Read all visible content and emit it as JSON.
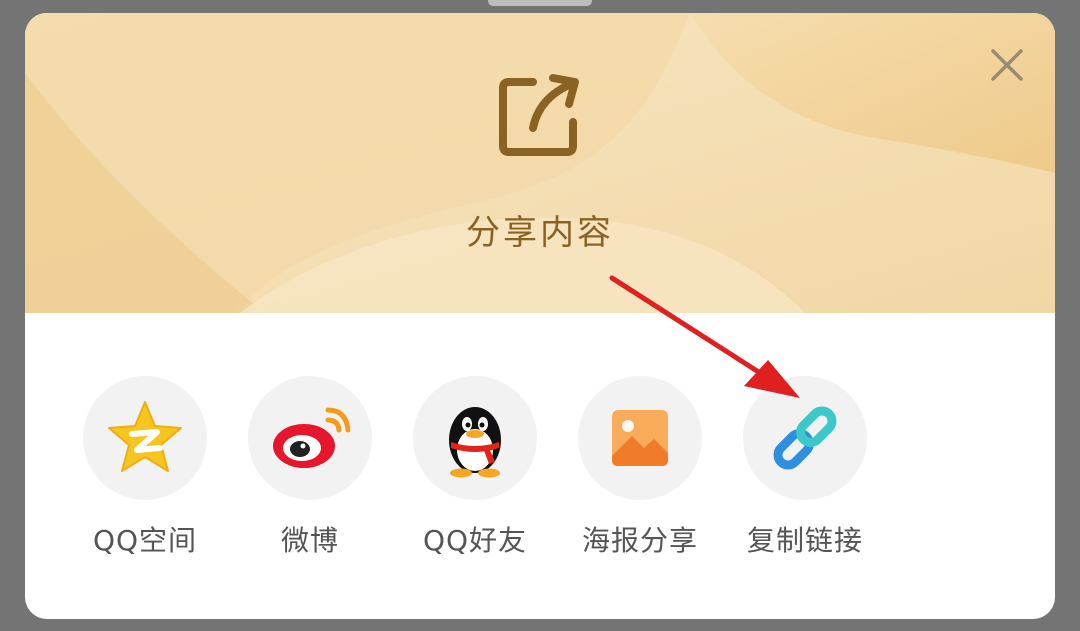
{
  "dialog": {
    "title": "分享内容",
    "header_icon": "share-external-icon",
    "close_icon": "close-icon"
  },
  "options": [
    {
      "label": "QQ空间",
      "icon": "qzone-star-icon"
    },
    {
      "label": "微博",
      "icon": "weibo-icon"
    },
    {
      "label": "QQ好友",
      "icon": "qq-penguin-icon"
    },
    {
      "label": "海报分享",
      "icon": "poster-image-icon"
    },
    {
      "label": "复制链接",
      "icon": "link-chain-icon"
    }
  ],
  "annotation": {
    "arrow_color": "#e01f1f",
    "points_to": "复制链接"
  },
  "colors": {
    "header_base": "#f5dfb6",
    "header_accent": "#efcf92",
    "title_text": "#8a6324",
    "label_text": "#555555"
  }
}
